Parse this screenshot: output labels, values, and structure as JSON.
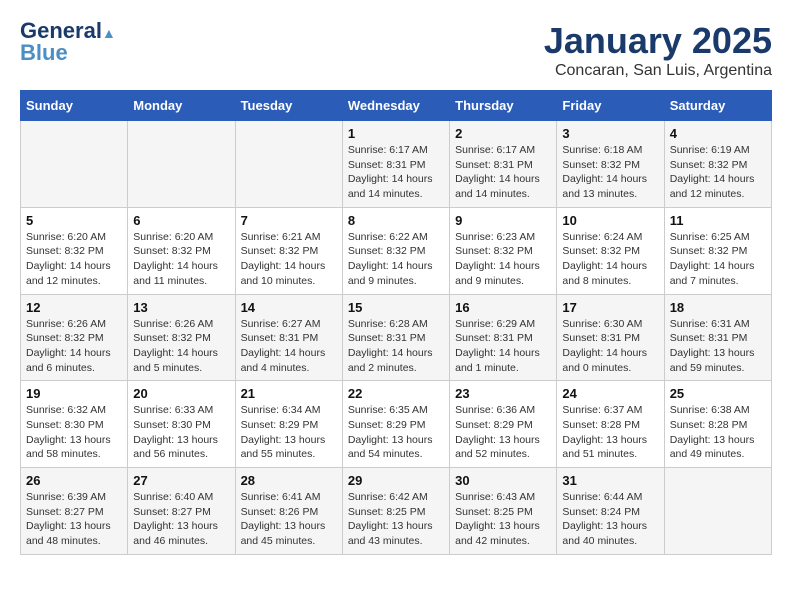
{
  "header": {
    "logo_line1": "General",
    "logo_line2": "Blue",
    "month": "January 2025",
    "location": "Concaran, San Luis, Argentina"
  },
  "days_of_week": [
    "Sunday",
    "Monday",
    "Tuesday",
    "Wednesday",
    "Thursday",
    "Friday",
    "Saturday"
  ],
  "weeks": [
    [
      {
        "day": "",
        "info": ""
      },
      {
        "day": "",
        "info": ""
      },
      {
        "day": "",
        "info": ""
      },
      {
        "day": "1",
        "info": "Sunrise: 6:17 AM\nSunset: 8:31 PM\nDaylight: 14 hours\nand 14 minutes."
      },
      {
        "day": "2",
        "info": "Sunrise: 6:17 AM\nSunset: 8:31 PM\nDaylight: 14 hours\nand 14 minutes."
      },
      {
        "day": "3",
        "info": "Sunrise: 6:18 AM\nSunset: 8:32 PM\nDaylight: 14 hours\nand 13 minutes."
      },
      {
        "day": "4",
        "info": "Sunrise: 6:19 AM\nSunset: 8:32 PM\nDaylight: 14 hours\nand 12 minutes."
      }
    ],
    [
      {
        "day": "5",
        "info": "Sunrise: 6:20 AM\nSunset: 8:32 PM\nDaylight: 14 hours\nand 12 minutes."
      },
      {
        "day": "6",
        "info": "Sunrise: 6:20 AM\nSunset: 8:32 PM\nDaylight: 14 hours\nand 11 minutes."
      },
      {
        "day": "7",
        "info": "Sunrise: 6:21 AM\nSunset: 8:32 PM\nDaylight: 14 hours\nand 10 minutes."
      },
      {
        "day": "8",
        "info": "Sunrise: 6:22 AM\nSunset: 8:32 PM\nDaylight: 14 hours\nand 9 minutes."
      },
      {
        "day": "9",
        "info": "Sunrise: 6:23 AM\nSunset: 8:32 PM\nDaylight: 14 hours\nand 9 minutes."
      },
      {
        "day": "10",
        "info": "Sunrise: 6:24 AM\nSunset: 8:32 PM\nDaylight: 14 hours\nand 8 minutes."
      },
      {
        "day": "11",
        "info": "Sunrise: 6:25 AM\nSunset: 8:32 PM\nDaylight: 14 hours\nand 7 minutes."
      }
    ],
    [
      {
        "day": "12",
        "info": "Sunrise: 6:26 AM\nSunset: 8:32 PM\nDaylight: 14 hours\nand 6 minutes."
      },
      {
        "day": "13",
        "info": "Sunrise: 6:26 AM\nSunset: 8:32 PM\nDaylight: 14 hours\nand 5 minutes."
      },
      {
        "day": "14",
        "info": "Sunrise: 6:27 AM\nSunset: 8:31 PM\nDaylight: 14 hours\nand 4 minutes."
      },
      {
        "day": "15",
        "info": "Sunrise: 6:28 AM\nSunset: 8:31 PM\nDaylight: 14 hours\nand 2 minutes."
      },
      {
        "day": "16",
        "info": "Sunrise: 6:29 AM\nSunset: 8:31 PM\nDaylight: 14 hours\nand 1 minute."
      },
      {
        "day": "17",
        "info": "Sunrise: 6:30 AM\nSunset: 8:31 PM\nDaylight: 14 hours\nand 0 minutes."
      },
      {
        "day": "18",
        "info": "Sunrise: 6:31 AM\nSunset: 8:31 PM\nDaylight: 13 hours\nand 59 minutes."
      }
    ],
    [
      {
        "day": "19",
        "info": "Sunrise: 6:32 AM\nSunset: 8:30 PM\nDaylight: 13 hours\nand 58 minutes."
      },
      {
        "day": "20",
        "info": "Sunrise: 6:33 AM\nSunset: 8:30 PM\nDaylight: 13 hours\nand 56 minutes."
      },
      {
        "day": "21",
        "info": "Sunrise: 6:34 AM\nSunset: 8:29 PM\nDaylight: 13 hours\nand 55 minutes."
      },
      {
        "day": "22",
        "info": "Sunrise: 6:35 AM\nSunset: 8:29 PM\nDaylight: 13 hours\nand 54 minutes."
      },
      {
        "day": "23",
        "info": "Sunrise: 6:36 AM\nSunset: 8:29 PM\nDaylight: 13 hours\nand 52 minutes."
      },
      {
        "day": "24",
        "info": "Sunrise: 6:37 AM\nSunset: 8:28 PM\nDaylight: 13 hours\nand 51 minutes."
      },
      {
        "day": "25",
        "info": "Sunrise: 6:38 AM\nSunset: 8:28 PM\nDaylight: 13 hours\nand 49 minutes."
      }
    ],
    [
      {
        "day": "26",
        "info": "Sunrise: 6:39 AM\nSunset: 8:27 PM\nDaylight: 13 hours\nand 48 minutes."
      },
      {
        "day": "27",
        "info": "Sunrise: 6:40 AM\nSunset: 8:27 PM\nDaylight: 13 hours\nand 46 minutes."
      },
      {
        "day": "28",
        "info": "Sunrise: 6:41 AM\nSunset: 8:26 PM\nDaylight: 13 hours\nand 45 minutes."
      },
      {
        "day": "29",
        "info": "Sunrise: 6:42 AM\nSunset: 8:25 PM\nDaylight: 13 hours\nand 43 minutes."
      },
      {
        "day": "30",
        "info": "Sunrise: 6:43 AM\nSunset: 8:25 PM\nDaylight: 13 hours\nand 42 minutes."
      },
      {
        "day": "31",
        "info": "Sunrise: 6:44 AM\nSunset: 8:24 PM\nDaylight: 13 hours\nand 40 minutes."
      },
      {
        "day": "",
        "info": ""
      }
    ]
  ]
}
